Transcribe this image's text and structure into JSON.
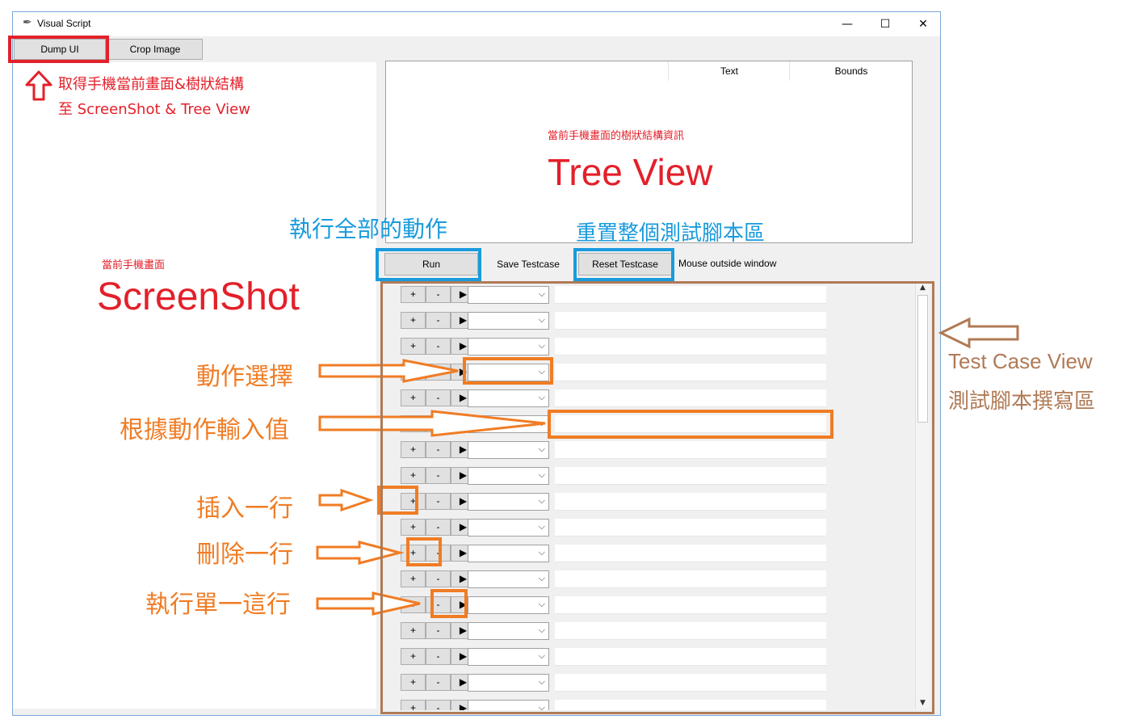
{
  "window": {
    "title": "Visual Script",
    "controls": {
      "minimize": "—",
      "maximize": "☐",
      "close": "✕"
    }
  },
  "toolbar": {
    "dump_ui": "Dump UI",
    "crop_image": "Crop Image"
  },
  "tree": {
    "columns": [
      "Text",
      "Bounds"
    ]
  },
  "actions": {
    "run": "Run",
    "save_testcase": "Save Testcase",
    "reset_testcase": "Reset Testcase",
    "status": "Mouse outside window"
  },
  "row_controls": {
    "plus": "+",
    "minus": "-",
    "play": "▶",
    "dropdown": "⌵"
  },
  "annotations": {
    "dump_ui_desc_1": "取得手機當前畫面&樹狀結構",
    "dump_ui_desc_2": "至 ScreenShot & Tree View",
    "tree_sub": "當前手機畫面的樹狀結構資訊",
    "tree_title": "Tree View",
    "run_desc": "執行全部的動作",
    "reset_desc": "重置整個測試腳本區",
    "screenshot_sub": "當前手機畫面",
    "screenshot_title": "ScreenShot",
    "action_select": "動作選擇",
    "input_value": "根據動作輸入值",
    "insert_row": "插入一行",
    "delete_row": "刪除一行",
    "run_row": "執行單一這行",
    "testcase_title": "Test Case View",
    "testcase_sub": "測試腳本撰寫區"
  },
  "colors": {
    "red": "#e3202a",
    "blue": "#1a9bdc",
    "orange": "#f07c24",
    "brown": "#b07a55"
  }
}
